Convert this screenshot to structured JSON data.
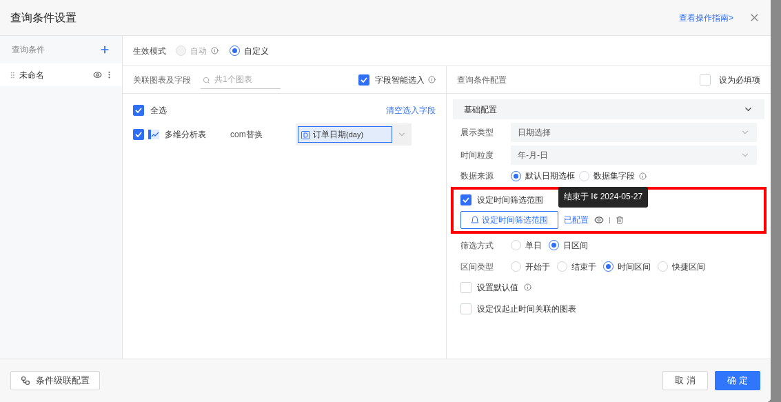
{
  "dialog": {
    "title": "查询条件设置",
    "guide_link": "查看操作指南>"
  },
  "sidebar": {
    "title": "查询条件",
    "items": [
      {
        "label": "未命名",
        "selected": true
      }
    ]
  },
  "mode": {
    "label": "生效模式",
    "options": [
      {
        "label": "自动",
        "selected": false,
        "disabled": true,
        "info": true
      },
      {
        "label": "自定义",
        "selected": true,
        "disabled": false,
        "info": false
      }
    ]
  },
  "linked": {
    "label": "关联图表及字段",
    "search_placeholder": "共1个图表",
    "smart": {
      "label": "字段智能选入",
      "checked": true
    },
    "select_all": {
      "label": "全选",
      "checked": true
    },
    "clear_link": "清空选入字段",
    "rows": [
      {
        "checked": true,
        "name": "多维分析表",
        "dataset": "com替换",
        "field": "订单日期",
        "field_suffix": "(day)"
      }
    ]
  },
  "config": {
    "title": "查询条件配置",
    "required": {
      "label": "设为必填项",
      "checked": false
    },
    "section": {
      "label": "基础配置",
      "expanded": true
    },
    "selects": [
      {
        "label": "展示类型",
        "value": "日期选择"
      },
      {
        "label": "时间粒度",
        "value": "年-月-日"
      }
    ],
    "source": {
      "label": "数据来源",
      "options": [
        {
          "label": "默认日期选框",
          "selected": true,
          "info": false
        },
        {
          "label": "数据集字段",
          "selected": false,
          "info": true
        }
      ]
    },
    "range": {
      "label": "设定时间筛选范围",
      "checked": true,
      "button": "设定时间筛选范围",
      "status": "已配置",
      "tooltip": "结束于 I¢ 2024-05-27"
    },
    "radio_groups": [
      {
        "label": "筛选方式",
        "options": [
          {
            "label": "单日",
            "selected": false
          },
          {
            "label": "日区间",
            "selected": true
          }
        ]
      },
      {
        "label": "区间类型",
        "options": [
          {
            "label": "开始于",
            "selected": false
          },
          {
            "label": "结束于",
            "selected": false
          },
          {
            "label": "时间区间",
            "selected": true
          },
          {
            "label": "快捷区间",
            "selected": false
          }
        ]
      }
    ],
    "checks": [
      {
        "label": "设置默认值",
        "checked": false,
        "info": true
      },
      {
        "label": "设定仅起止时间关联的图表",
        "checked": false,
        "info": false
      }
    ]
  },
  "footer": {
    "cascade": "条件级联配置",
    "cancel": "取 消",
    "ok": "确 定"
  }
}
